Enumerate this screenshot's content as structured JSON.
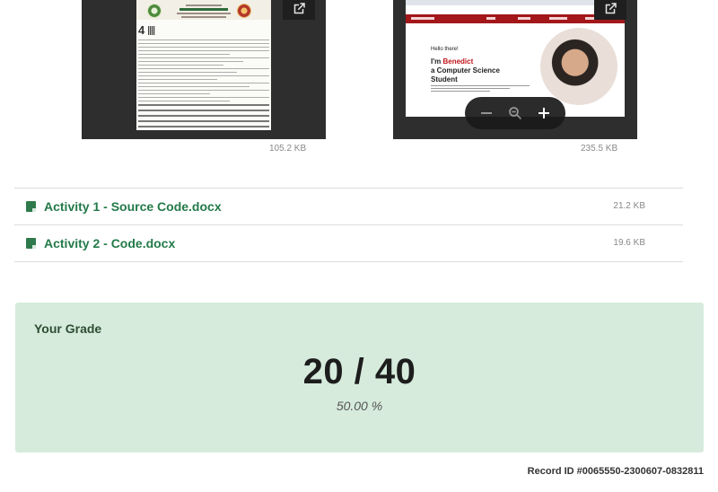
{
  "attachments": [
    {
      "size": "105.2 KB"
    },
    {
      "size": "235.5 KB"
    }
  ],
  "site_preview": {
    "greeting": "Hello there!",
    "intro_prefix": "I'm ",
    "intro_name": "Benedict",
    "intro_line2": "a Computer Science",
    "intro_line3": "Student"
  },
  "files": [
    {
      "name": "Activity 1 - Source Code.docx",
      "size": "21.2 KB"
    },
    {
      "name": "Activity 2 - Code.docx",
      "size": "19.6 KB"
    }
  ],
  "grade": {
    "title": "Your Grade",
    "score": "20 / 40",
    "percent": "50.00 %"
  },
  "record_id": "Record ID #0065550-2300607-0832811",
  "colors": {
    "accent": "#237a49",
    "grade_bg": "#d6ebdc",
    "preview_bg": "#2e2e2e"
  },
  "icons": [
    "open-in-new-icon",
    "zoom-out-icon",
    "zoom-reset-icon",
    "zoom-in-icon",
    "document-icon"
  ]
}
